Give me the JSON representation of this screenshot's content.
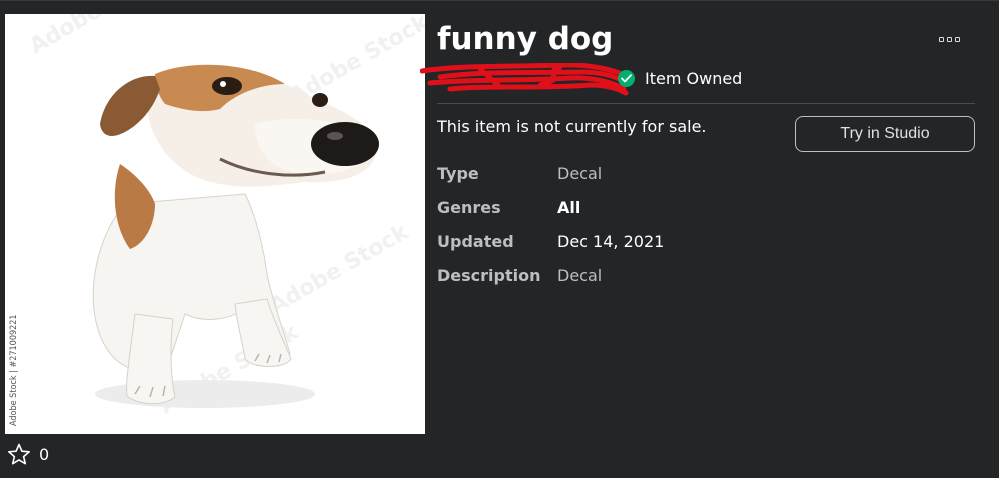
{
  "item": {
    "title": "funny dog",
    "ownership": "Item Owned",
    "sale_status": "This item is not currently for sale.",
    "try_button_label": "Try in Studio",
    "favorites_count": "0"
  },
  "thumbnail": {
    "watermark_side": "Adobe Stock | #271009221",
    "watermark_text": "Adobe Stock"
  },
  "details": [
    {
      "label": "Type",
      "value": "Decal",
      "emphasis": false
    },
    {
      "label": "Genres",
      "value": "All",
      "emphasis": true
    },
    {
      "label": "Updated",
      "value": "Dec 14, 2021",
      "emphasis": false
    },
    {
      "label": "Description",
      "value": "Decal",
      "emphasis": false
    }
  ],
  "icons": {
    "more": "more-options-icon",
    "favorite": "star-outline-icon",
    "owned": "checkmark-circle-icon",
    "redaction": "red-scribble-redaction"
  },
  "colors": {
    "background": "#232527",
    "owned_green": "#00b06f",
    "redaction_red": "#e0101a",
    "label_grey": "#bdbebe"
  }
}
